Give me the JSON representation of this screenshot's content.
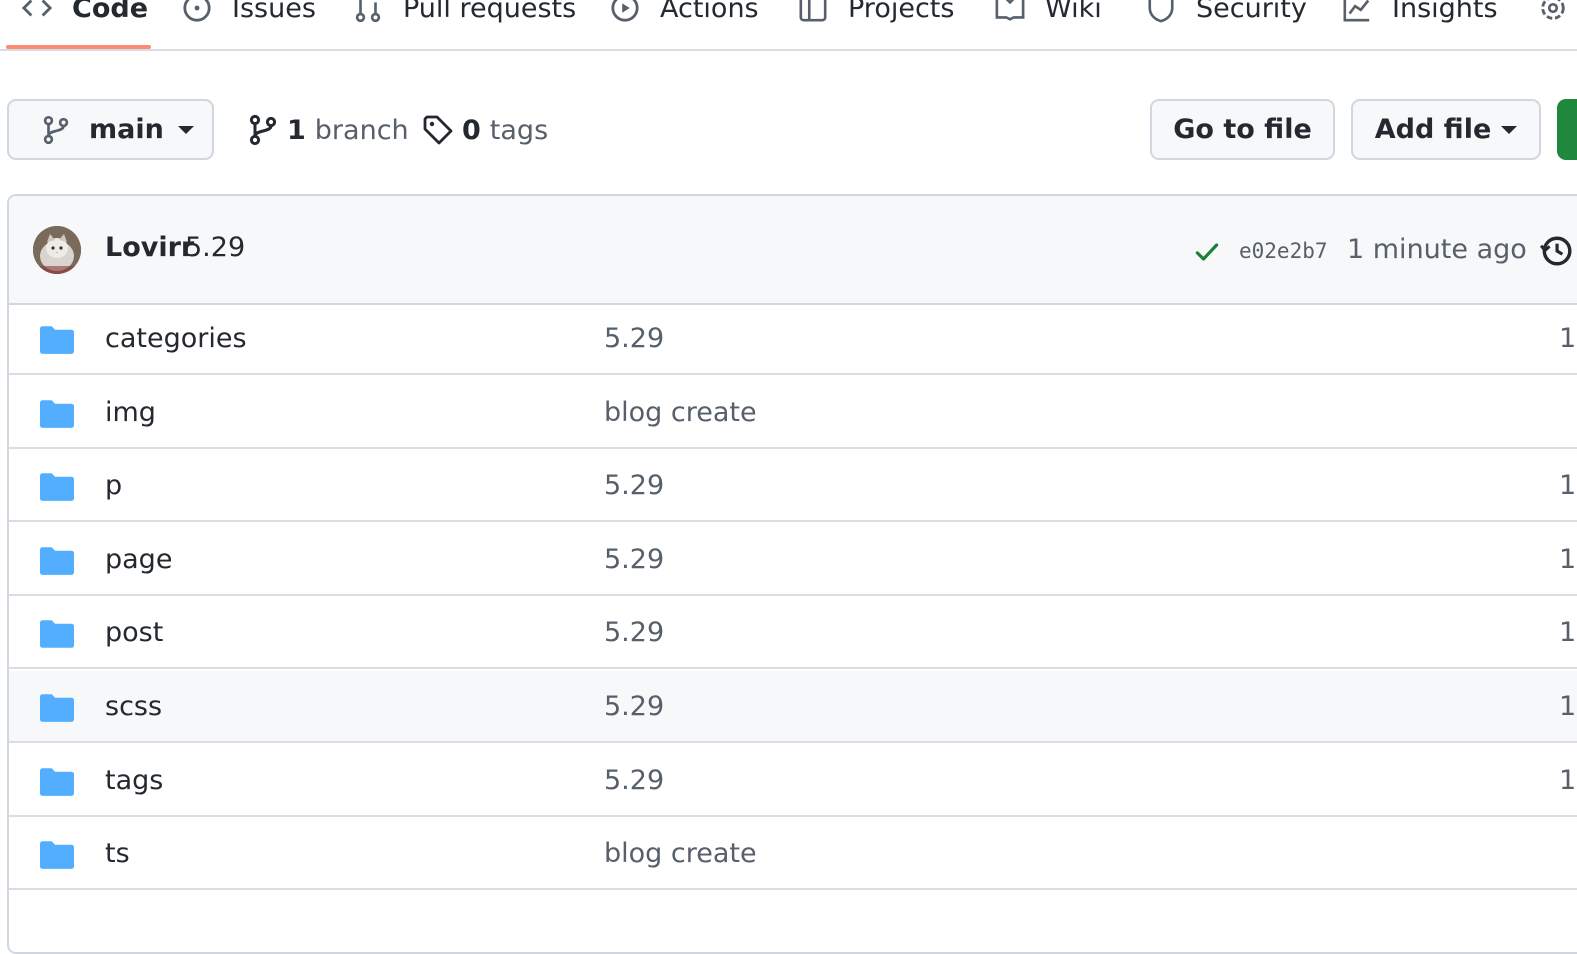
{
  "tabs": [
    {
      "label": "Code",
      "icon": "code-icon",
      "selected": true
    },
    {
      "label": "Issues",
      "icon": "issue-icon"
    },
    {
      "label": "Pull requests",
      "icon": "pull-request-icon"
    },
    {
      "label": "Actions",
      "icon": "play-icon"
    },
    {
      "label": "Projects",
      "icon": "project-icon"
    },
    {
      "label": "Wiki",
      "icon": "book-icon"
    },
    {
      "label": "Security",
      "icon": "shield-icon"
    },
    {
      "label": "Insights",
      "icon": "graph-icon"
    }
  ],
  "toolbar": {
    "branch": "main",
    "branches_count": "1",
    "branches_label": "branch",
    "tags_count": "0",
    "tags_label": "tags",
    "goto_label": "Go to file",
    "add_label": "Add file"
  },
  "commit": {
    "author": "Lovirr",
    "message": "5.29",
    "sha": "e02e2b7",
    "time": "1 minute ago"
  },
  "files": [
    {
      "name": "categories",
      "message": "5.29",
      "age": "1"
    },
    {
      "name": "img",
      "message": "blog create",
      "age": ""
    },
    {
      "name": "p",
      "message": "5.29",
      "age": "1"
    },
    {
      "name": "page",
      "message": "5.29",
      "age": "1"
    },
    {
      "name": "post",
      "message": "5.29",
      "age": "1"
    },
    {
      "name": "scss",
      "message": "5.29",
      "age": "1"
    },
    {
      "name": "tags",
      "message": "5.29",
      "age": "1"
    },
    {
      "name": "ts",
      "message": "blog create",
      "age": ""
    }
  ],
  "colors": {
    "accent_underline": "#fd8c73",
    "folder": "#54aeff",
    "success": "#1a7f37",
    "primary_button": "#1f883d"
  }
}
